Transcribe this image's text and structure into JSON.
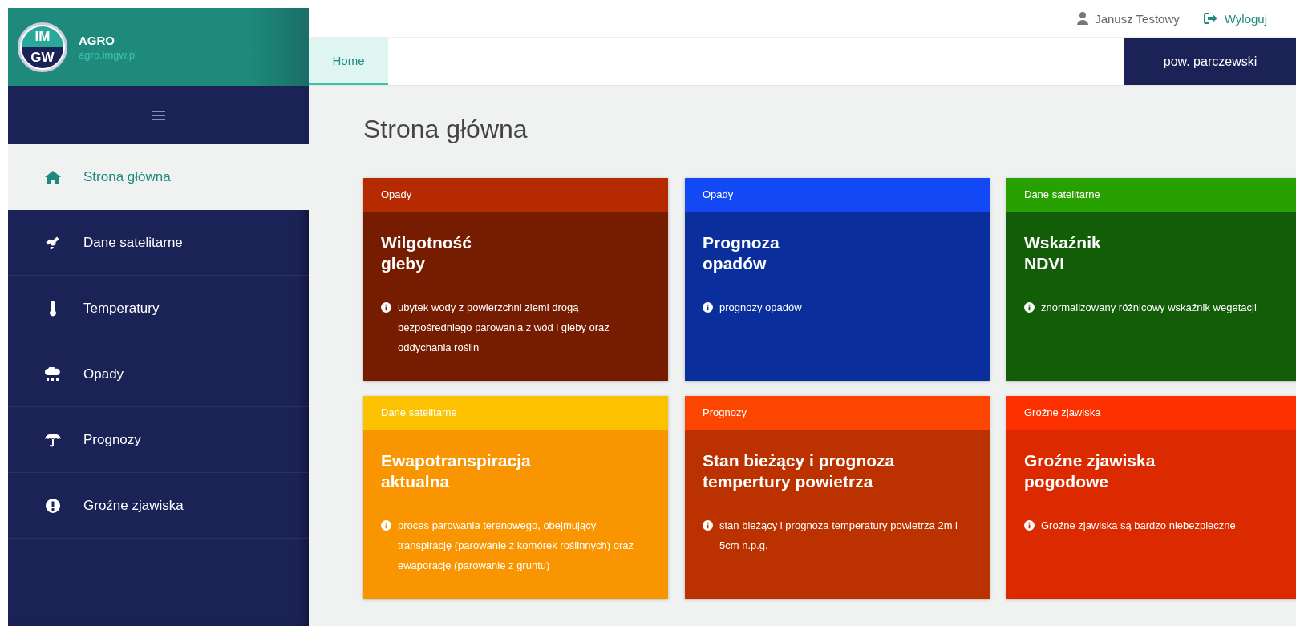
{
  "logo": {
    "top": "IM",
    "bottom": "GW"
  },
  "brand": {
    "title": "AGRO",
    "subtitle": "agro.imgw.pl"
  },
  "sidebar": {
    "items": [
      {
        "label": "Strona główna",
        "selected": true
      },
      {
        "label": "Dane satelitarne",
        "selected": false
      },
      {
        "label": "Temperatury",
        "selected": false
      },
      {
        "label": "Opady",
        "selected": false
      },
      {
        "label": "Prognozy",
        "selected": false
      },
      {
        "label": "Groźne zjawiska",
        "selected": false
      }
    ]
  },
  "user": {
    "name": "Janusz Testowy",
    "logout": "Wyloguj"
  },
  "tabs": [
    {
      "label": "Home",
      "selected": true
    }
  ],
  "region": "pow. parczewski",
  "page_title": "Strona główna",
  "cards": [
    {
      "category": "Opady",
      "color": "#b52a00",
      "body": {
        "color": "#761c00"
      },
      "title": "Wilgotność\ngleby",
      "description": "ubytek wody z powierzchni ziemi drogą bezpośredniego parowania z wód i gleby oraz oddychania roślin"
    },
    {
      "category": "Opady",
      "color": "#1249f5",
      "body": {
        "color": "#0a2f9c"
      },
      "title": "Prognoza\nopadów",
      "description": "prognozy opadów"
    },
    {
      "category": "Dane satelitarne",
      "color": "#28a000",
      "body": {
        "color": "#135c08"
      },
      "title": "Wskaźnik\nNDVI",
      "description": "znormalizowany różnicowy wskaźnik wegetacji"
    },
    {
      "category": "Dane satelitarne",
      "color": "#fcc200",
      "body": {
        "color": "#f99500"
      },
      "title": "Ewapotranspiracja\naktualna",
      "description": "proces parowania terenowego, obejmujący transpirację (parowanie z komórek roślinnych) oraz ewaporację (parowanie z gruntu)"
    },
    {
      "category": "Prognozy",
      "color": "#fb4500",
      "body": {
        "color": "#bb3200"
      },
      "title": "Stan bieżący i prognoza\ntempertury powietrza",
      "description": "stan bieżący i prognoza temperatury powietrza 2m i 5cm n.p.g."
    },
    {
      "category": "Groźne zjawiska",
      "color": "#fd3000",
      "body": {
        "color": "#dc2a00"
      },
      "title": "Groźne zjawiska\npogodowe",
      "description": "Groźne zjawiska są bardzo niebezpieczne"
    }
  ]
}
